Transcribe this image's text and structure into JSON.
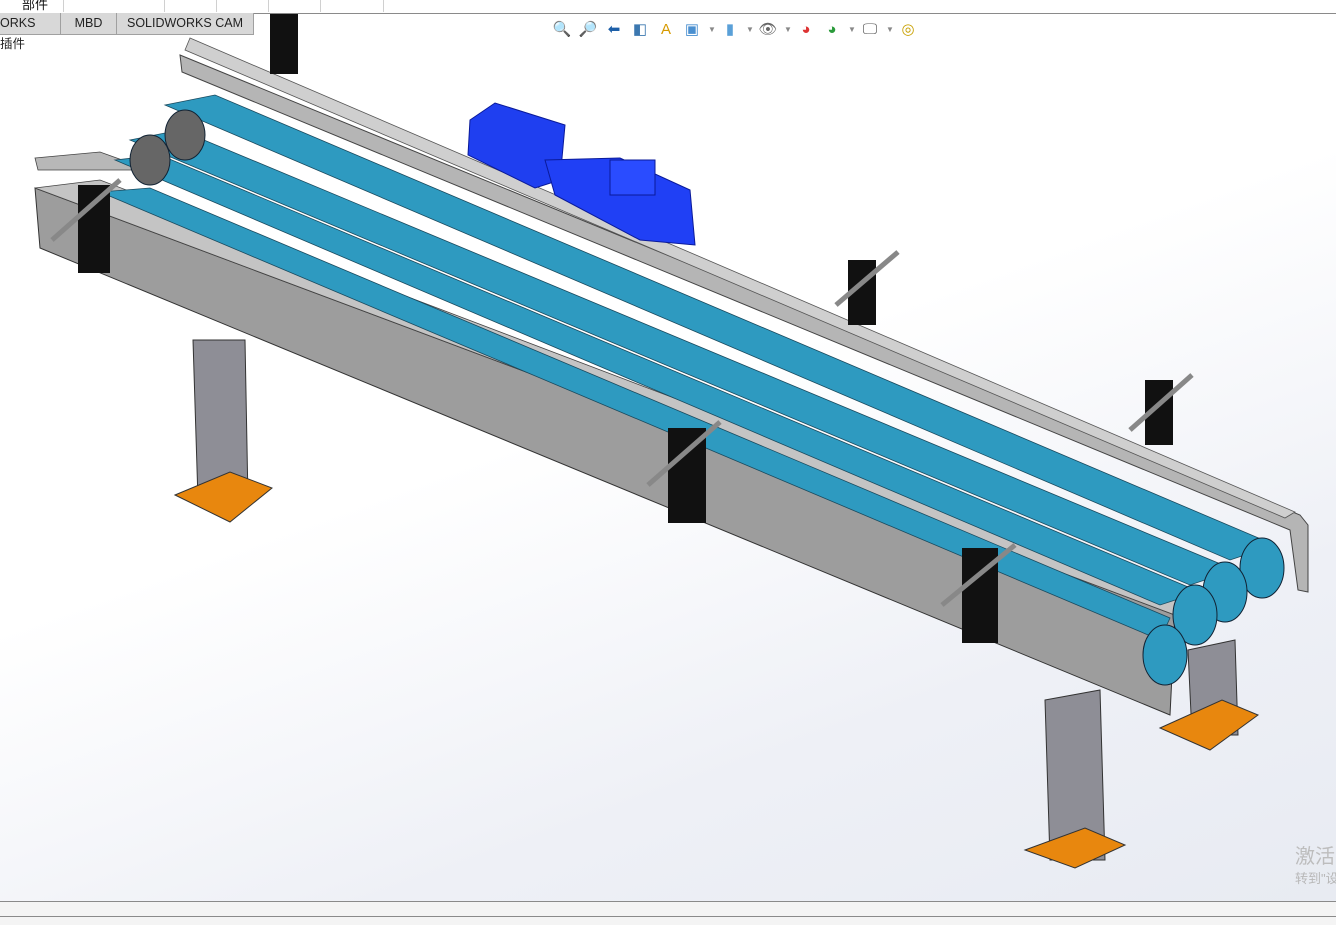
{
  "top_toolbar": {
    "partial_label": "部件"
  },
  "tabs": [
    {
      "label": "ORKS 插件"
    },
    {
      "label": "MBD"
    },
    {
      "label": "SOLIDWORKS CAM"
    }
  ],
  "heads_up_toolbar": {
    "icons": [
      "zoom-to-fit-icon",
      "zoom-to-area-icon",
      "previous-view-icon",
      "section-view-icon",
      "dynamic-annotation-view-icon",
      "view-orientation-icon",
      "display-style-icon",
      "hide-show-items-icon",
      "edit-appearance-icon",
      "apply-scene-icon",
      "view-settings-icon",
      "measure-icon"
    ]
  },
  "model": {
    "belt_color": "#2e9ac0",
    "motor_color": "#1f3ff0",
    "frame_color": "#a3a3a3",
    "foot_color": "#e8870e"
  },
  "watermark": {
    "line1": "激活",
    "line2": "转到\"设"
  }
}
